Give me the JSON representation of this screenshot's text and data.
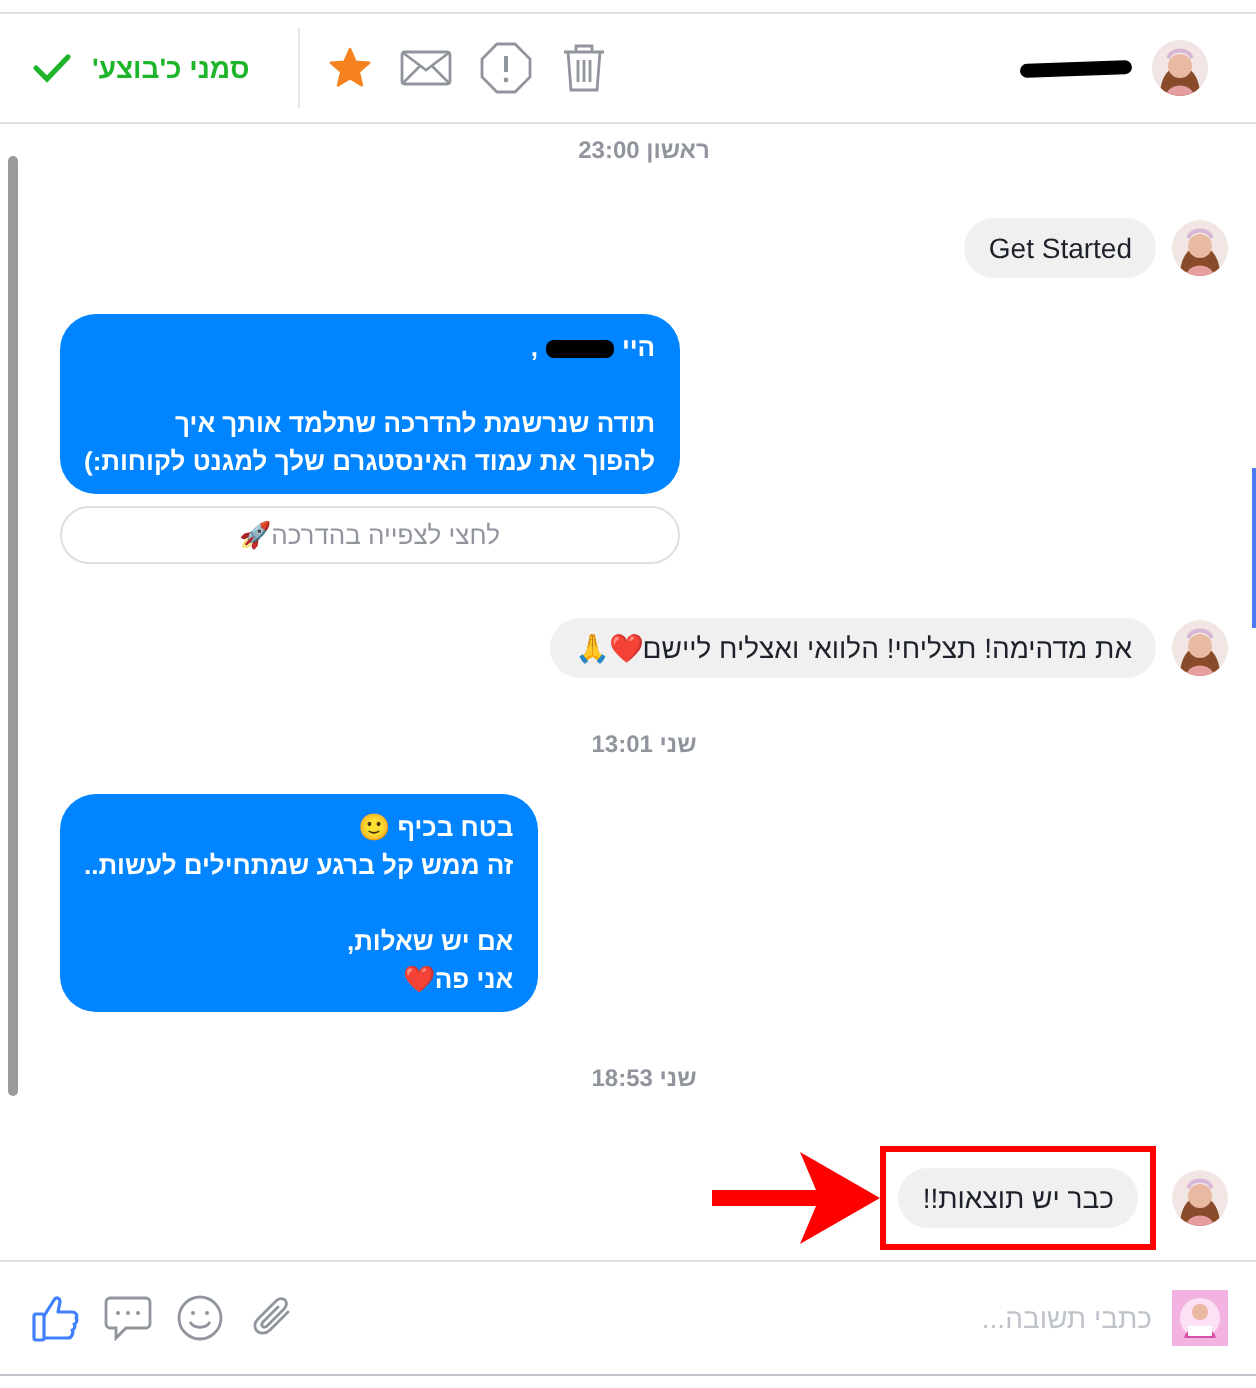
{
  "header": {
    "done_label": "סמני כ'בוצע'",
    "starred": true,
    "name_redacted": true
  },
  "messages": [
    {
      "kind": "time",
      "text": "ראשון 23:00"
    },
    {
      "kind": "incoming",
      "text": "Get Started",
      "highlighted": false
    },
    {
      "kind": "outgoing",
      "paragraphs": [
        {
          "lines": [
            {
              "text": "היי",
              "redacted_after": true,
              "suffix": ","
            }
          ]
        },
        {
          "lines": [
            {
              "text": "תודה שנרשמת להדרכה שתלמד אותך איך"
            },
            {
              "text": "להפוך את עמוד האינסטגרם שלך למגנט לקוחות:)"
            }
          ]
        }
      ],
      "quick_reply": "לחצי לצפייה בהדרכה🚀"
    },
    {
      "kind": "incoming",
      "text": "את מדהימה! תצליחי! הלוואי ואצליח ליישם❤️🙏",
      "highlighted": false
    },
    {
      "kind": "time",
      "text": "שני 13:01"
    },
    {
      "kind": "outgoing",
      "paragraphs": [
        {
          "lines": [
            {
              "text": "בטח בכיף 🙂"
            },
            {
              "text": "זה ממש קל ברגע שמתחילים לעשות.."
            }
          ]
        },
        {
          "lines": [
            {
              "text": "אם יש שאלות,"
            },
            {
              "text": "אני פה❤️"
            }
          ]
        }
      ]
    },
    {
      "kind": "time",
      "text": "שני 18:53"
    },
    {
      "kind": "incoming",
      "text": "כבר יש תוצאות!!",
      "highlighted": true
    }
  ],
  "composer": {
    "placeholder": "כתבי תשובה..."
  }
}
